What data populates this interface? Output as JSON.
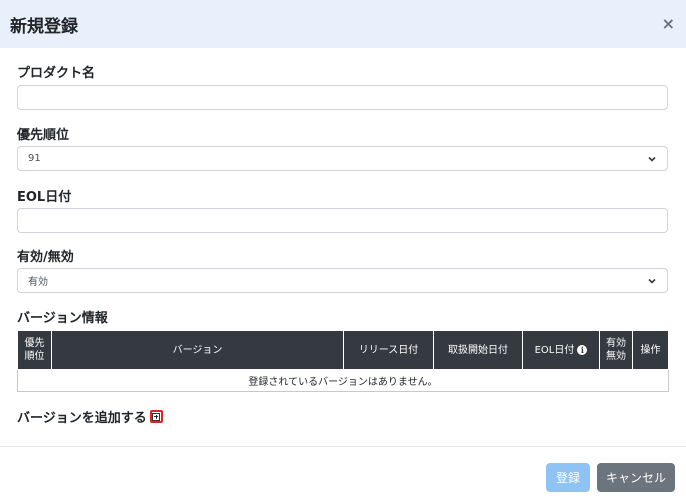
{
  "modal": {
    "title": "新規登録",
    "close_label": "×"
  },
  "form": {
    "product_name": {
      "label": "プロダクト名",
      "value": ""
    },
    "priority": {
      "label": "優先順位",
      "selected": "91"
    },
    "eol_date": {
      "label": "EOL日付",
      "value": ""
    },
    "active": {
      "label": "有効/無効",
      "selected": "有効"
    }
  },
  "versions": {
    "title": "バージョン情報",
    "headers": {
      "priority": "優先順位",
      "version": "バージョン",
      "release_date": "リリース日付",
      "handling_start_date": "取扱開始日付",
      "eol_date": "EOL日付",
      "active": "有効無効",
      "operation": "操作"
    },
    "empty_message": "登録されているバージョンはありません。",
    "add_label": "バージョンを追加する"
  },
  "footer": {
    "submit_label": "登録",
    "cancel_label": "キャンセル"
  },
  "colors": {
    "header_bg": "#e8f1fb",
    "table_header_bg": "#343a40",
    "primary_button": "#8fc3f3",
    "secondary_button": "#6c757d",
    "add_highlight": "#dc2626"
  }
}
